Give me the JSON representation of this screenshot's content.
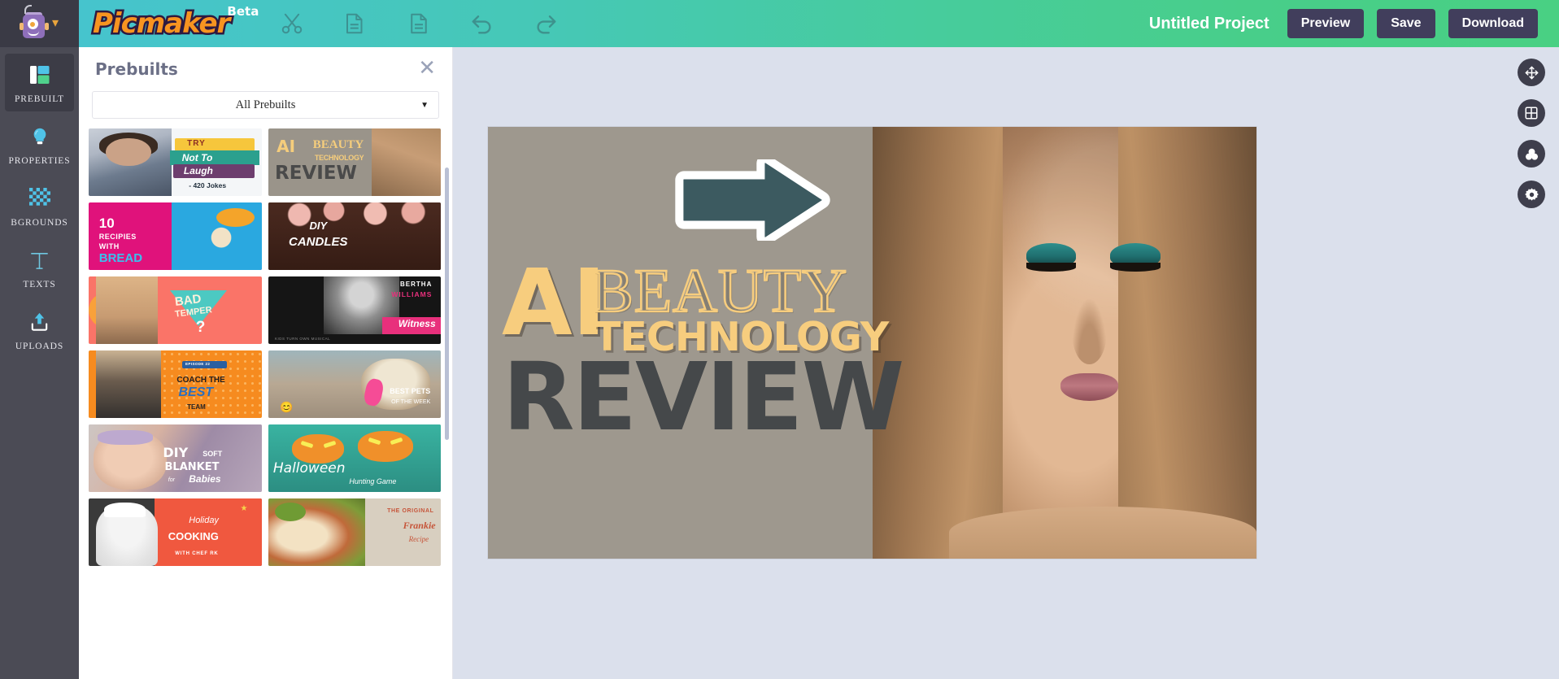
{
  "header": {
    "brand_name": "Picmaker",
    "brand_badge": "Beta",
    "brand_caret_icon": "chevron-down-icon",
    "logo_mascot_icon": "robot-mascot-icon",
    "tools": [
      {
        "name": "cut-icon",
        "label": "Cut"
      },
      {
        "name": "copy-icon",
        "label": "Copy"
      },
      {
        "name": "paste-icon",
        "label": "Paste"
      },
      {
        "name": "undo-icon",
        "label": "Undo"
      },
      {
        "name": "redo-icon",
        "label": "Redo"
      }
    ],
    "project_title": "Untitled Project",
    "preview_label": "Preview",
    "save_label": "Save",
    "download_label": "Download",
    "gradient_start": "#46c3d1",
    "gradient_end": "#49d083",
    "button_bg": "#413e5c"
  },
  "sidebar": {
    "items": [
      {
        "label": "PREBUILT",
        "icon": "prebuilt-grid-icon",
        "active": true
      },
      {
        "label": "PROPERTIES",
        "icon": "lightbulb-icon",
        "active": false
      },
      {
        "label": "BGROUNDS",
        "icon": "checkerboard-icon",
        "active": false
      },
      {
        "label": "TEXTS",
        "icon": "text-t-icon",
        "active": false
      },
      {
        "label": "UPLOADS",
        "icon": "upload-arrow-icon",
        "active": false
      }
    ]
  },
  "panel": {
    "title": "Prebuilts",
    "close_icon": "close-icon",
    "filter_value": "All Prebuilts",
    "filter_caret_icon": "chevron-down-icon",
    "thumbnails": [
      {
        "id": "try-not-to-laugh",
        "lines": [
          "TRY",
          "Not To",
          "Laugh",
          "- 420 Jokes"
        ]
      },
      {
        "id": "ai-beauty-technology-review",
        "lines": [
          "AI",
          "BEAUTY",
          "TECHNOLOGY",
          "REVIEW"
        ]
      },
      {
        "id": "10-recipies-with-bread",
        "lines": [
          "10",
          "RECIPIES",
          "WITH",
          "BREAD"
        ]
      },
      {
        "id": "diy-candles",
        "lines": [
          "DIY",
          "CANDLES"
        ]
      },
      {
        "id": "bad-temper",
        "lines": [
          "BAD",
          "TEMPER",
          "?"
        ]
      },
      {
        "id": "bertha-williams-witness",
        "lines": [
          "BERTHA",
          "WILLIAMS",
          "Witness",
          "KIDS TURN OWN MUSICAL"
        ]
      },
      {
        "id": "coach-the-best-team",
        "lines": [
          "EPISODE 22",
          "COACH THE",
          "BEST",
          "TEAM"
        ]
      },
      {
        "id": "best-pets-of-the-week",
        "lines": [
          "BEST PETS",
          "OF THE WEEK",
          "😊"
        ]
      },
      {
        "id": "diy-soft-blanket-for-babies",
        "lines": [
          "DIY",
          "SOFT",
          "BLANKET",
          "for",
          "Babies"
        ]
      },
      {
        "id": "halloween-hunting-game",
        "lines": [
          "Halloween",
          "Hunting Game"
        ]
      },
      {
        "id": "holiday-cooking-with-chef-rk",
        "lines": [
          "Holiday",
          "COOKING",
          "WITH CHEF RK"
        ]
      },
      {
        "id": "the-original-frankie-recipe",
        "lines": [
          "THE ORIGINAL",
          "Frankie",
          "Recipe"
        ]
      }
    ]
  },
  "canvas": {
    "headline_ai": "AI",
    "headline_beauty": "BEAUTY",
    "headline_technology": "TECHNOLOGY",
    "headline_review": "REVIEW",
    "arrow_icon": "right-arrow-sticker-icon",
    "gold_color": "#f7cd7e",
    "dark_color": "#45484a",
    "background_color": "#9e988e"
  },
  "right_tools": [
    {
      "name": "move-icon",
      "label": "Move / Pan"
    },
    {
      "name": "grid-icon",
      "label": "Grid"
    },
    {
      "name": "color-wheel-icon",
      "label": "Colors"
    },
    {
      "name": "gear-icon",
      "label": "Settings"
    }
  ]
}
